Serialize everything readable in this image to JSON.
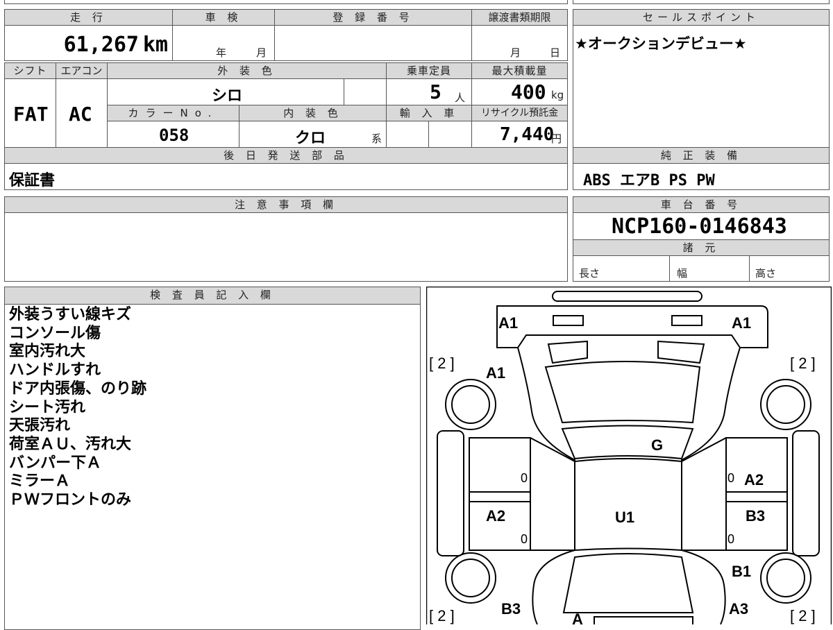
{
  "labels": {
    "mileage": "走 行",
    "inspection": "車 検",
    "registration": "登 録 番 号",
    "transfer_deadline": "譲渡書類期限",
    "sales_point": "セールスポイント",
    "shift": "シフト",
    "aircon": "エアコン",
    "exterior_color": "外 装 色",
    "capacity": "乗車定員",
    "max_load": "最大積載量",
    "color_no": "カラーNo.",
    "interior_color": "内 装 色",
    "import": "輸 入 車",
    "recycle_fee": "リサイクル預託金",
    "later_parts": "後 日 発 送 部 品",
    "standard_equipment": "純 正 装 備",
    "caution": "注 意 事 項 欄",
    "chassis_no": "車 台 番 号",
    "specs": "諸 元",
    "length": "長さ",
    "width": "幅",
    "height": "高さ",
    "inspector_notes": "検 査 員 記 入 欄"
  },
  "values": {
    "mileage": "61,267",
    "mileage_unit": "km",
    "year_unit": "年",
    "month_unit": "月",
    "day_unit": "日",
    "sales_point": "★オークションデビュー★",
    "shift": "FAT",
    "aircon": "AC",
    "exterior_color": "シロ",
    "capacity": "5",
    "capacity_unit": "人",
    "max_load": "400",
    "max_load_unit": "kg",
    "color_no": "058",
    "interior_color": "クロ",
    "interior_suffix": "系",
    "recycle_fee": "7,440",
    "recycle_unit": "円",
    "later_parts": "保証書",
    "standard_equipment": "ABS エアB PS PW",
    "chassis_no": "NCP160-0146843"
  },
  "inspector_notes": [
    "外装うすい線キズ",
    "コンソール傷",
    "室内汚れ大",
    "ハンドルすれ",
    "ドア内張傷、のり跡",
    "シート汚れ",
    "天張汚れ",
    "荷室ＡＵ、汚れ大",
    "バンパー下Ａ",
    "ミラーＡ",
    "ＰＷフロントのみ"
  ],
  "diagram": {
    "marks": {
      "front_left": "A1",
      "front_right": "A1",
      "hood_left": "A1",
      "windshield": "G",
      "rear_right_door": "A2",
      "front_left_door": "A2",
      "front_right_door": "B3",
      "roof": "U1",
      "rear_right_fender": "B1",
      "rear_left_fender": "B3",
      "rear_right": "A3",
      "rear_bumper": "A"
    },
    "tire_depth": [
      "2",
      "2",
      "2",
      "2"
    ],
    "door_zero": [
      "0",
      "0",
      "0",
      "0"
    ]
  }
}
